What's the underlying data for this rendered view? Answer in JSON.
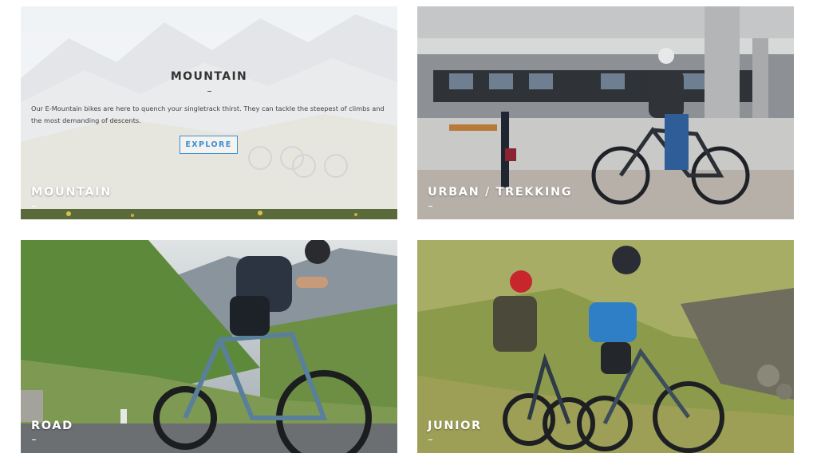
{
  "tiles": {
    "mountain": {
      "label": "MOUNTAIN",
      "overlay_title": "MOUNTAIN",
      "overlay_text": "Our E-Mountain bikes are here to quench your singletrack thirst. They can tackle the steepest of climbs and the most demanding of descents.",
      "button_label": "EXPLORE"
    },
    "urban": {
      "label": "URBAN / TREKKING"
    },
    "road": {
      "label": "ROAD"
    },
    "junior": {
      "label": "JUNIOR"
    }
  },
  "colors": {
    "accent": "#3a8fd6",
    "label_text": "#ffffff",
    "overlay_text": "#444444"
  },
  "icons": []
}
